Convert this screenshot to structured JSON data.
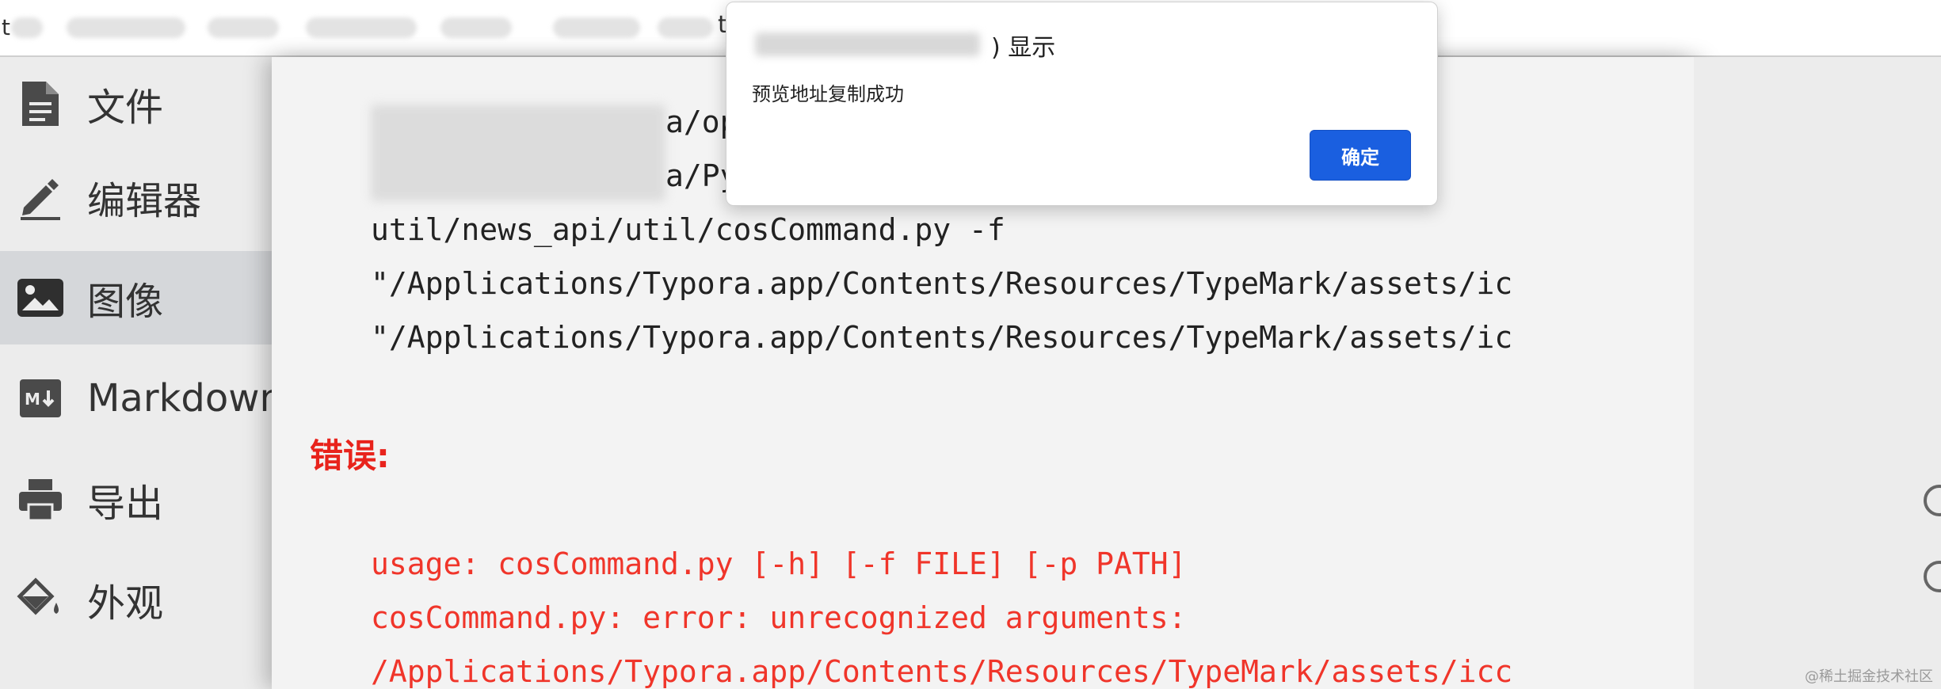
{
  "browser": {
    "leading_char": "t",
    "middle_char": "t"
  },
  "sidebar": {
    "items": [
      {
        "label": "文件",
        "icon": "file-icon",
        "active": false
      },
      {
        "label": "编辑器",
        "icon": "pen-icon",
        "active": false
      },
      {
        "label": "图像",
        "icon": "image-icon",
        "active": true
      },
      {
        "label": "Markdown",
        "icon": "markdown-icon",
        "active": false
      },
      {
        "label": "导出",
        "icon": "printer-icon",
        "active": false
      },
      {
        "label": "外观",
        "icon": "paint-bucket-icon",
        "active": false
      }
    ]
  },
  "document": {
    "partial_lines": [
      "a/op",
      "a/Py"
    ],
    "command_lines": [
      "util/news_api/util/cosCommand.py -f",
      "\"/Applications/Typora.app/Contents/Resources/TypeMark/assets/ic",
      "\"/Applications/Typora.app/Contents/Resources/TypeMark/assets/ic"
    ],
    "error_heading": "错误:",
    "error_lines": [
      "usage: cosCommand.py [-h] [-f FILE] [-p PATH]",
      "cosCommand.py: error: unrecognized arguments:",
      "/Applications/Typora.app/Contents/Resources/TypeMark/assets/icc"
    ]
  },
  "dialog": {
    "title_suffix": ") 显示",
    "message": "预览地址复制成功",
    "ok_label": "确定"
  },
  "watermark": "@稀土掘金技术社区",
  "colors": {
    "error_red": "#f0352a",
    "button_blue": "#1a5fe0",
    "active_item_bg": "#d5d7da"
  }
}
